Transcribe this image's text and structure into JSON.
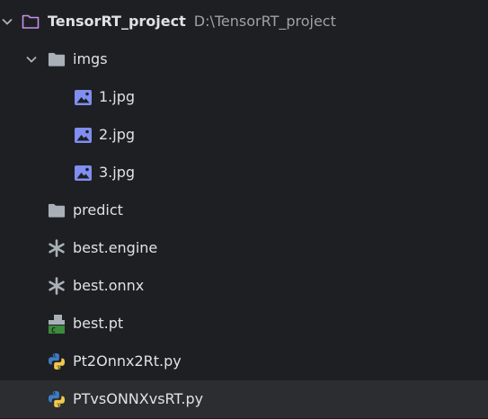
{
  "project": {
    "name": "TensorRT_project",
    "path": "D:\\TensorRT_project",
    "icon": "folder-outline-icon",
    "expanded": true
  },
  "items": [
    {
      "label": "imgs",
      "icon": "folder-icon",
      "expanded": true
    },
    {
      "label": "1.jpg",
      "icon": "image-file-icon"
    },
    {
      "label": "2.jpg",
      "icon": "image-file-icon"
    },
    {
      "label": "3.jpg",
      "icon": "image-file-icon"
    },
    {
      "label": "predict",
      "icon": "folder-icon"
    },
    {
      "label": "best.engine",
      "icon": "asterisk-file-icon"
    },
    {
      "label": "best.onnx",
      "icon": "asterisk-file-icon"
    },
    {
      "label": "best.pt",
      "icon": "binary-file-icon"
    },
    {
      "label": "Pt2Onnx2Rt.py",
      "icon": "python-file-icon"
    },
    {
      "label": "PTvsONNXvsRT.py",
      "icon": "python-file-icon",
      "selected": true
    }
  ],
  "colors": {
    "background": "#1e1f22",
    "selected_row": "#2b2d30",
    "text": "#dfe1e5",
    "path_text": "#9ea1a8",
    "folder": "#aab0b8",
    "project_folder": "#c792ea",
    "image_icon": "#7f8ef0",
    "python_blue": "#3f7cc4",
    "python_yellow": "#f2c94c",
    "pt_green": "#3c8a3c"
  }
}
